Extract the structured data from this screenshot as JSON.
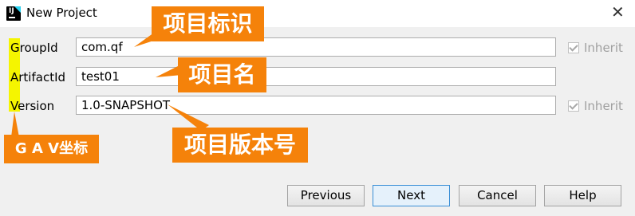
{
  "window": {
    "title": "New Project"
  },
  "form": {
    "group_label": "GroupId",
    "group_value": "com.qf",
    "artifact_label": "ArtifactId",
    "artifact_value": "test01",
    "version_label": "Version",
    "version_value": "1.0-SNAPSHOT",
    "inherit_label": "Inherit",
    "group_inherit_checked": true,
    "version_inherit_checked": true
  },
  "annotations": {
    "group_note": "项目标识",
    "artifact_note": "项目名",
    "version_note": "项目版本号",
    "gav_note": "G A V坐标"
  },
  "buttons": {
    "previous": "Previous",
    "next": "Next",
    "cancel": "Cancel",
    "help": "Help"
  },
  "colors": {
    "annotation_bg": "#f5820a",
    "highlight": "#f5f500",
    "primary_button_border": "#3a8fd6"
  }
}
